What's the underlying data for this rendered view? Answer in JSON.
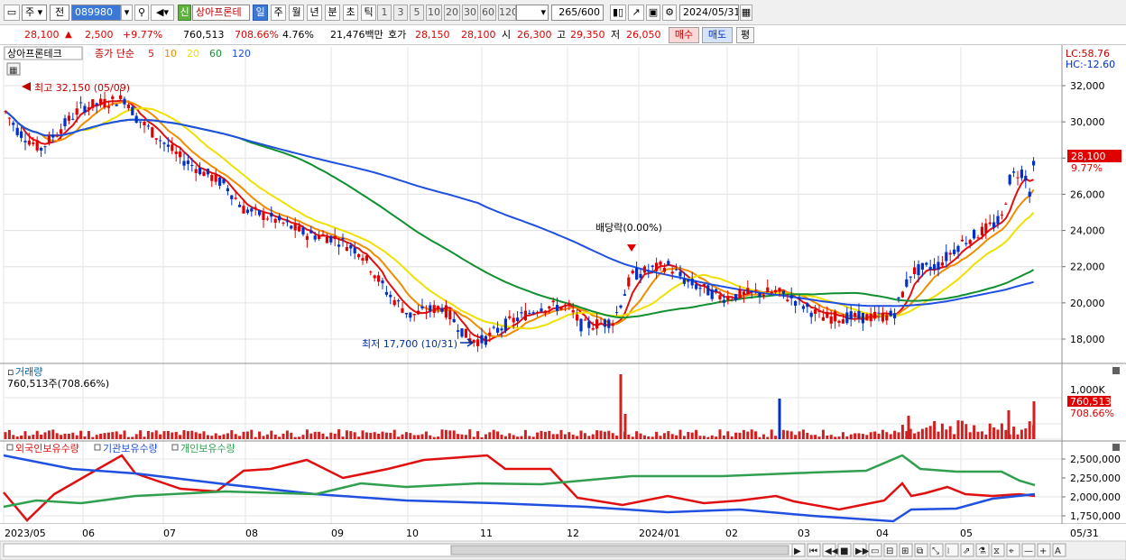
{
  "toolbar": {
    "period_select": "주",
    "prev_label": "전",
    "code_value": "089980",
    "market_tag": "신",
    "stock_name": "상아프론테",
    "periods": [
      "일",
      "주",
      "월",
      "년",
      "분",
      "초",
      "틱"
    ],
    "intervals": [
      "1",
      "3",
      "5",
      "10",
      "20",
      "30",
      "60",
      "120"
    ],
    "bar_count": "265",
    "bar_total": "/600",
    "date_value": "2024/05/31"
  },
  "quote": {
    "price": "28,100",
    "change_arrow": "▲",
    "change": "2,500",
    "change_pct": "+9.77%",
    "volume": "760,513",
    "volume_ratio": "708.66%",
    "turnover": "4.76%",
    "amount": "21,476백만",
    "bid_label": "호가",
    "bid1": "28,150",
    "bid2": "28,100",
    "open_label": "시",
    "open": "26,300",
    "high_label": "고",
    "high": "29,350",
    "low_label": "저",
    "low": "26,050",
    "buy_label": "매수",
    "sell_label": "매도",
    "eval_label": "평"
  },
  "price_panel": {
    "legend_name": "상아프론테크",
    "legend_ma_title": "종가 단순",
    "ma_periods": [
      "5",
      "10",
      "20",
      "60",
      "120"
    ],
    "ma_colors": [
      "#e01010",
      "#f08c00",
      "#f0e000",
      "#109030",
      "#2050e0"
    ],
    "lc_label": "LC:58.76",
    "hc_label": "HC:-12.60",
    "yticks": [
      "32,000",
      "30,000",
      "28,000",
      "26,000",
      "24,000",
      "22,000",
      "20,000",
      "18,000"
    ],
    "ytick_values": [
      32000,
      30000,
      28000,
      26000,
      24000,
      22000,
      20000,
      18000
    ],
    "last_price_tag": "28,100",
    "last_pct_tag": "9.77%",
    "high_annotation": "최고 32,150 (05/09)",
    "low_annotation": "최저 17,700 (10/31)",
    "dividend_annotation": "배당락(0.00%)"
  },
  "volume_panel": {
    "title": "거래량",
    "value_text": "760,513주(708.66%)",
    "ytick": "1,000K",
    "last_tag": "760,513",
    "last_pct": "708.66%",
    "bar_color": "#d02020"
  },
  "holding_panel": {
    "series_names": [
      "외국인보유수량",
      "기관보유수량",
      "개인보유수량"
    ],
    "series_colors": [
      "#e01010",
      "#2050e0",
      "#30a050"
    ],
    "yticks": [
      "2,500,000",
      "2,250,000",
      "2,000,000",
      "1,750,000"
    ]
  },
  "xaxis": {
    "labels": [
      "2023/05",
      "06",
      "07",
      "08",
      "09",
      "10",
      "11",
      "12",
      "2024/01",
      "02",
      "03",
      "04",
      "05",
      "05/31"
    ]
  },
  "colors": {
    "up": "#e00000",
    "down": "#0030c8",
    "accent": "#3b78d8"
  }
}
